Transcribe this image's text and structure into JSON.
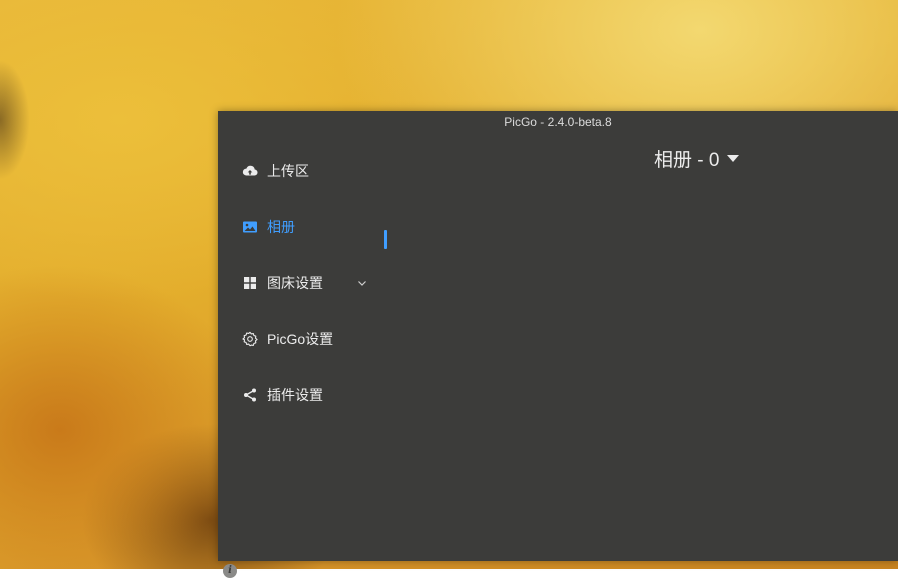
{
  "window": {
    "title": "PicGo - 2.4.0-beta.8"
  },
  "sidebar": {
    "items": [
      {
        "label": "上传区",
        "icon": "cloud-upload-icon",
        "active": false
      },
      {
        "label": "相册",
        "icon": "image-icon",
        "active": true
      },
      {
        "label": "图床设置",
        "icon": "grid-icon",
        "active": false,
        "expandable": true
      },
      {
        "label": "PicGo设置",
        "icon": "gear-icon",
        "active": false
      },
      {
        "label": "插件设置",
        "icon": "share-icon",
        "active": false
      }
    ]
  },
  "main": {
    "title": "相册 - 0"
  },
  "colors": {
    "accent": "#409eff",
    "window_bg": "#3c3c3a",
    "text": "#ececec"
  },
  "info": {
    "icon": "info-icon",
    "glyph": "i"
  }
}
